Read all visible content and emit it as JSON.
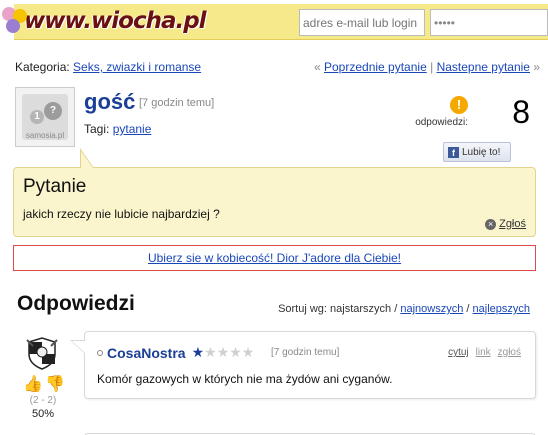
{
  "header": {
    "logo_text": "www.wiocha.pl",
    "email_placeholder": "adres e-mail lub login",
    "password_mask": "•••••"
  },
  "category": {
    "label": "Kategoria:",
    "value": "Seks, zwiazki i romanse"
  },
  "navigation": {
    "prev_arrow": "«",
    "prev_label": "Poprzednie pytanie",
    "separator": "|",
    "next_label": "Nastepne pytanie",
    "next_arrow": "»"
  },
  "question_meta": {
    "avatar_caption": "samosia.pl",
    "author": "gość",
    "time": "[7 godzin temu]",
    "tags_label": "Tagi:",
    "tag": "pytanie",
    "answers_label": "odpowiedzi:",
    "answers_count": "8",
    "like_label": "Lubię to!"
  },
  "question": {
    "title": "Pytanie",
    "body": "jakich rzeczy nie lubicie najbardziej ?",
    "report_label": "Zgłoś"
  },
  "ad": {
    "text": "Ubierz sie w kobiecość! Dior J'adore dla Ciebie!"
  },
  "answers_section": {
    "heading": "Odpowiedzi",
    "sort_label": "Sortuj wg: najstarszych /",
    "sort_newest": "najnowszych",
    "sort_sep": "/",
    "sort_best": "najlepszych"
  },
  "answers": [
    {
      "author": "CosaNostra",
      "rating_stars": 1,
      "rating_max": 5,
      "time": "[7 godzin temu]",
      "quote_label": "cytuj",
      "link_label": "link",
      "report_label": "zgłoś",
      "body": "Komór gazowych w których nie ma żydów ani cyganów.",
      "vote_score": "(2 - 2)",
      "vote_percent": "50%"
    }
  ],
  "colors": {
    "header_yellow": "#f6e98a",
    "link_blue": "#1a47b8",
    "author_blue": "#1a3f96",
    "question_bg": "#fbf5cd",
    "ad_border": "#e04a4a"
  }
}
